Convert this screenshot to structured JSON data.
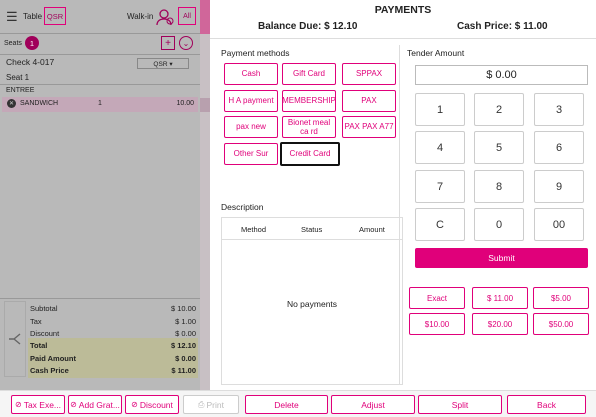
{
  "left": {
    "table_label": "Table",
    "qsr_badge": "QSR",
    "walkin_label": "Walk-in",
    "all_label": "All",
    "seats_label": "Seats",
    "seats_count": "1",
    "plus_label": "+",
    "check_title": "Check 4-017",
    "qsr_dropdown": "QSR ▾",
    "seat_label": "Seat 1",
    "entree_label": "ENTREE",
    "item": {
      "name": "SANDWICH",
      "qty": "1",
      "price": "10.00"
    },
    "totals": [
      {
        "label": "Subtotal",
        "value": "$ 10.00"
      },
      {
        "label": "Tax",
        "value": "$ 1.00"
      },
      {
        "label": "Discount",
        "value": "$ 0.00"
      },
      {
        "label": "Total",
        "value": "$ 12.10"
      },
      {
        "label": "Paid Amount",
        "value": "$ 0.00"
      },
      {
        "label": "Cash Price",
        "value": "$ 11.00"
      }
    ]
  },
  "dialog": {
    "title": "PAYMENTS",
    "balance_due": "Balance Due: $ 12.10",
    "cash_price": "Cash Price: $ 11.00",
    "payment_methods_heading": "Payment methods",
    "methods": [
      "Cash",
      "Gift Card",
      "SPPAX",
      "H A payment",
      "MEMBERSHIP",
      "PAX",
      "pax new",
      "Bionet meal ca rd",
      "PAX PAX A77",
      "Other Sur",
      "Credit Card"
    ],
    "selected_method": "Credit Card",
    "tender_heading": "Tender Amount",
    "tender_value": "$ 0.00",
    "keypad": [
      "1",
      "2",
      "3",
      "4",
      "5",
      "6",
      "7",
      "8",
      "9",
      "C",
      "0",
      "00"
    ],
    "submit_label": "Submit",
    "quick_amounts": [
      "Exact",
      "$ 11.00",
      "$5.00",
      "$10.00",
      "$20.00",
      "$50.00"
    ],
    "description_heading": "Description",
    "columns": [
      "Method",
      "Status",
      "Amount"
    ],
    "empty_text": "No payments"
  },
  "bottom": {
    "buttons": [
      "Tax Exe...",
      "Add Grat...",
      "Discount",
      "Print",
      "Delete",
      "Adjust",
      "Split",
      "Back"
    ]
  },
  "colors": {
    "accent": "#e0007a",
    "dim_overlay": "#b9b9b9",
    "total_band": "#d8d6a8"
  }
}
